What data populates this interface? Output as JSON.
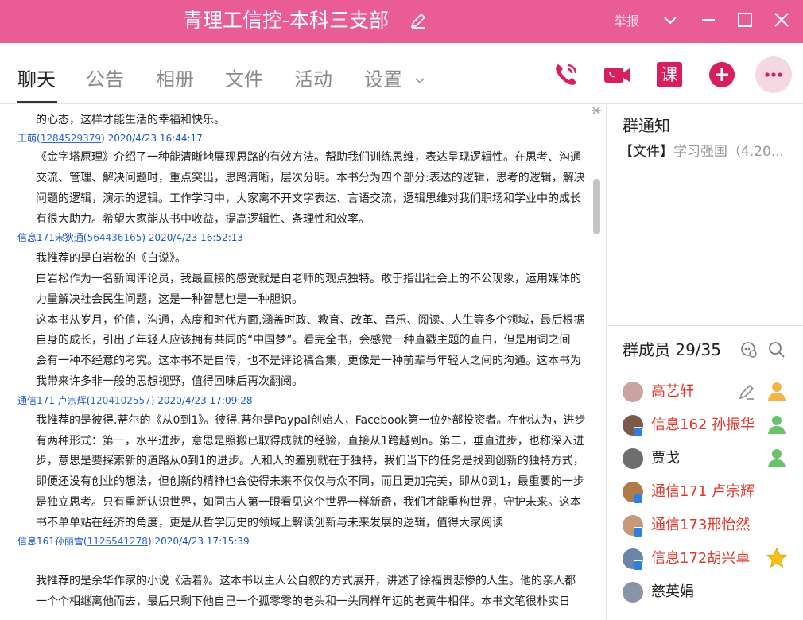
{
  "window": {
    "title": "青理工信控-本科三支部",
    "report_label": "举报"
  },
  "tabs": [
    "聊天",
    "公告",
    "相册",
    "文件",
    "活动",
    "设置"
  ],
  "toolbar": {
    "call_icon": "phone-icon",
    "video_icon": "video-camera-icon",
    "class_label": "课",
    "add_icon": "plus-circle-icon",
    "more_icon": "more-dots-icon"
  },
  "colors": {
    "brand": "#ea5c95",
    "member_name": "#e0372c",
    "meta_blue": "#1a55c7"
  },
  "chat": {
    "top_line": "的心态，这样才能生活的幸福和快乐。",
    "messages": [
      {
        "sender": "王萌",
        "uid": "1284529379",
        "time": "2020/4/23 16:44:17",
        "lines": [
          "《金字塔原理》介绍了一种能清晰地展现思路的有效方法。帮助我们训练思维，表达呈现逻辑性。在思考、沟通",
          "交流、管理、解决问题时，重点突出，思路清晰，层次分明。本书分为四个部分:表达的逻辑，思考的逻辑，解决",
          "问题的逻辑，演示的逻辑。工作学习中，大家离不开文字表达、言语交流，逻辑思维对我们职场和学业中的成长",
          "有很大助力。希望大家能从书中收益，提高逻辑性、条理性和效率。"
        ]
      },
      {
        "sender": "信息171宋狄通",
        "uid": "564436165",
        "time": "2020/4/23 16:52:13",
        "lines": [
          "我推荐的是白岩松的《白说》。",
          "白岩松作为一名新闻评论员，我最直接的感受就是白老师的观点独特。敢于指出社会上的不公现象，运用媒体的",
          "力量解决社会民生问题，这是一种智慧也是一种胆识。",
          "这本书从岁月，价值，沟通，态度和时代方面,涵盖时政、教育、改革、音乐、阅读、人生等多个领域，最后根据",
          "自身的成长，引出了年轻人应该拥有共同的“中国梦”。看完全书，会感觉一种直戳主题的直白，但是用词之间",
          "会有一种不经意的考究。这本书不是自传，也不是评论稿合集，更像是一种前辈与年轻人之间的沟通。这本书为",
          "我带来许多非一般的思想视野，值得回味后再次翻阅。"
        ]
      },
      {
        "sender": "通信171 卢宗辉",
        "uid": "1204102557",
        "time": "2020/4/23 17:09:28",
        "lines": [
          "我推荐的是彼得.蒂尔的《从0到1》。彼得.蒂尔是Paypal创始人，Facebook第一位外部投资者。在他认为，进步",
          "有两种形式：第一，水平进步，意思是照搬已取得成就的经验，直接从1跨越到n。第二，垂直进步，也称深入进",
          "步，意思是要探索新的道路从0到1的进步。人和人的差别就在于独特，我们当下的任务是找到创新的独特方式，",
          "即便还没有创业的想法，但创新的精神也会使得未来不仅仅与众不同，而且更加完美，即从0到1，最重要的一步",
          "是独立思考。只有重新认识世界，如同古人第一眼看见这个世界一样新奇，我们才能重构世界，守护未来。这本",
          "书不单单站在经济的角度，更是从哲学历史的领域上解读创新与未来发展的逻辑，值得大家阅读"
        ]
      },
      {
        "sender": "信息161孙丽雪",
        "uid": "1125541278",
        "time": "2020/4/23 17:15:39",
        "lines": [
          "我推荐的是余华作家的小说《活着》。这本书以主人公自叙的方式展开，讲述了徐福贵悲惨的人生。他的亲人都",
          "一个个相继离他而去，最后只剩下他自己一个孤零零的老头和一头同样年迈的老黄牛相伴。本书文笔很朴实日"
        ]
      }
    ]
  },
  "right_panel": {
    "notice_title": "群通知",
    "notice_prefix": "【文件】",
    "notice_text": "学习强国（4.20...",
    "members_title": "群成员 29/35",
    "members": [
      {
        "name": "高艺轩",
        "avatar_color": "#caa3a0",
        "red": true,
        "mobile": false,
        "role": "owner",
        "right_icon": "admin-person-icon"
      },
      {
        "name": "信息162 孙振华",
        "avatar_color": "#7a5a4a",
        "red": true,
        "mobile": true,
        "role": "admin",
        "right_icon": "admin-person-icon"
      },
      {
        "name": "贾戈",
        "avatar_color": "#6e6e6e",
        "red": false,
        "mobile": false,
        "role": "admin",
        "right_icon": "admin-person-icon"
      },
      {
        "name": "通信171 卢宗辉",
        "avatar_color": "#b07a4a",
        "red": true,
        "mobile": true,
        "role": "member",
        "right_icon": ""
      },
      {
        "name": "通信173邢怡然",
        "avatar_color": "#c49a7a",
        "red": true,
        "mobile": true,
        "role": "member",
        "right_icon": ""
      },
      {
        "name": "信息172胡兴卓",
        "avatar_color": "#6b84a8",
        "red": true,
        "mobile": true,
        "role": "member",
        "right_icon": "star-level-icon"
      },
      {
        "name": "慈英娟",
        "avatar_color": "#8a94a8",
        "red": false,
        "mobile": false,
        "role": "member",
        "right_icon": ""
      }
    ]
  }
}
